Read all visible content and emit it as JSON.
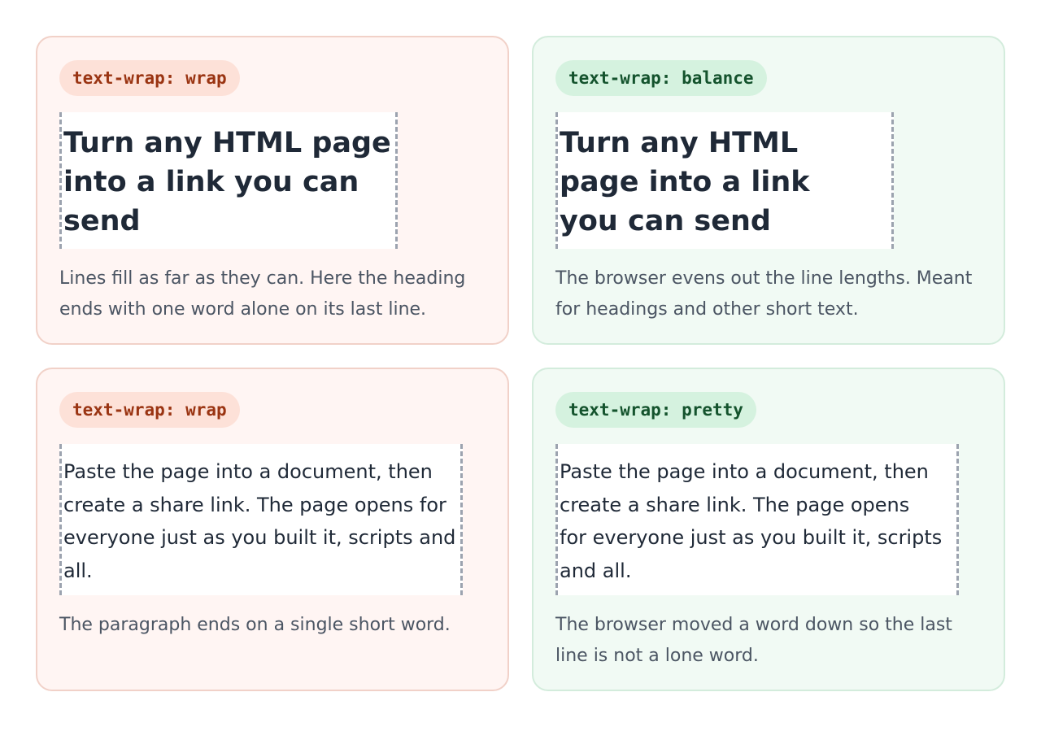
{
  "cards": [
    {
      "tag": "text-wrap: wrap",
      "demo_lines": [
        "Turn any HTML page",
        "into a link you can",
        "send"
      ],
      "desc_lines": [
        "Lines fill as far as they can. Here the heading",
        "ends with one word alone on its last line."
      ]
    },
    {
      "tag": "text-wrap: balance",
      "demo_lines": [
        "Turn any HTML",
        "page into a link",
        "you can send"
      ],
      "desc_lines": [
        "The browser evens out the line lengths. Meant",
        "for headings and other short text."
      ]
    },
    {
      "tag": "text-wrap: wrap",
      "demo_lines": [
        "Paste the page into a document, then",
        "create a share link. The page opens for",
        "everyone just as you built it, scripts and",
        "all."
      ],
      "desc_lines": [
        "The paragraph ends on a single short word."
      ]
    },
    {
      "tag": "text-wrap: pretty",
      "demo_lines": [
        "Paste the page into a document, then",
        "create a share link. The page opens",
        "for everyone just as you built it, scripts",
        "and all."
      ],
      "desc_lines": [
        "The browser moved a word down so the last",
        "line is not a lone word."
      ]
    }
  ],
  "colors": {
    "bad_bg": "#fff5f3",
    "bad_accent": "#9a3412",
    "good_bg": "#f1faf4",
    "good_accent": "#14532d"
  }
}
